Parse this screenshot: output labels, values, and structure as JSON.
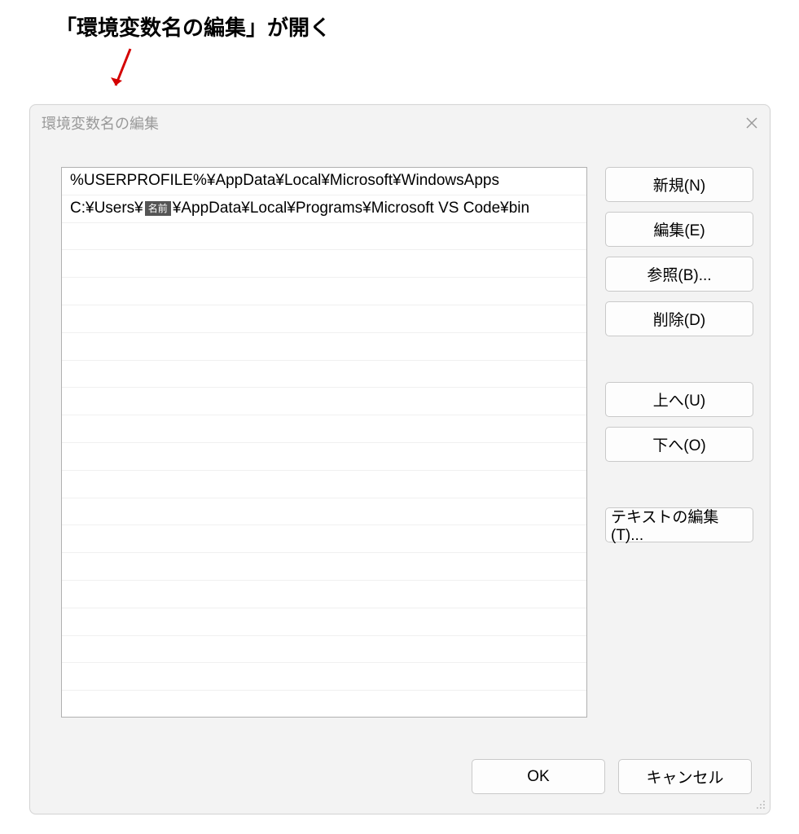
{
  "annotation": {
    "text": "「環境変数名の編集」が開く"
  },
  "dialog": {
    "title": "環境変数名の編集",
    "list": {
      "row1": "%USERPROFILE%¥AppData¥Local¥Microsoft¥WindowsApps",
      "row2_prefix": "C:¥Users¥",
      "row2_redacted": "名前",
      "row2_suffix": "¥AppData¥Local¥Programs¥Microsoft VS Code¥bin"
    },
    "buttons": {
      "new": "新規(N)",
      "edit": "編集(E)",
      "browse": "参照(B)...",
      "delete": "削除(D)",
      "up": "上へ(U)",
      "down": "下へ(O)",
      "edit_text": "テキストの編集(T)..."
    },
    "footer": {
      "ok": "OK",
      "cancel": "キャンセル"
    }
  }
}
